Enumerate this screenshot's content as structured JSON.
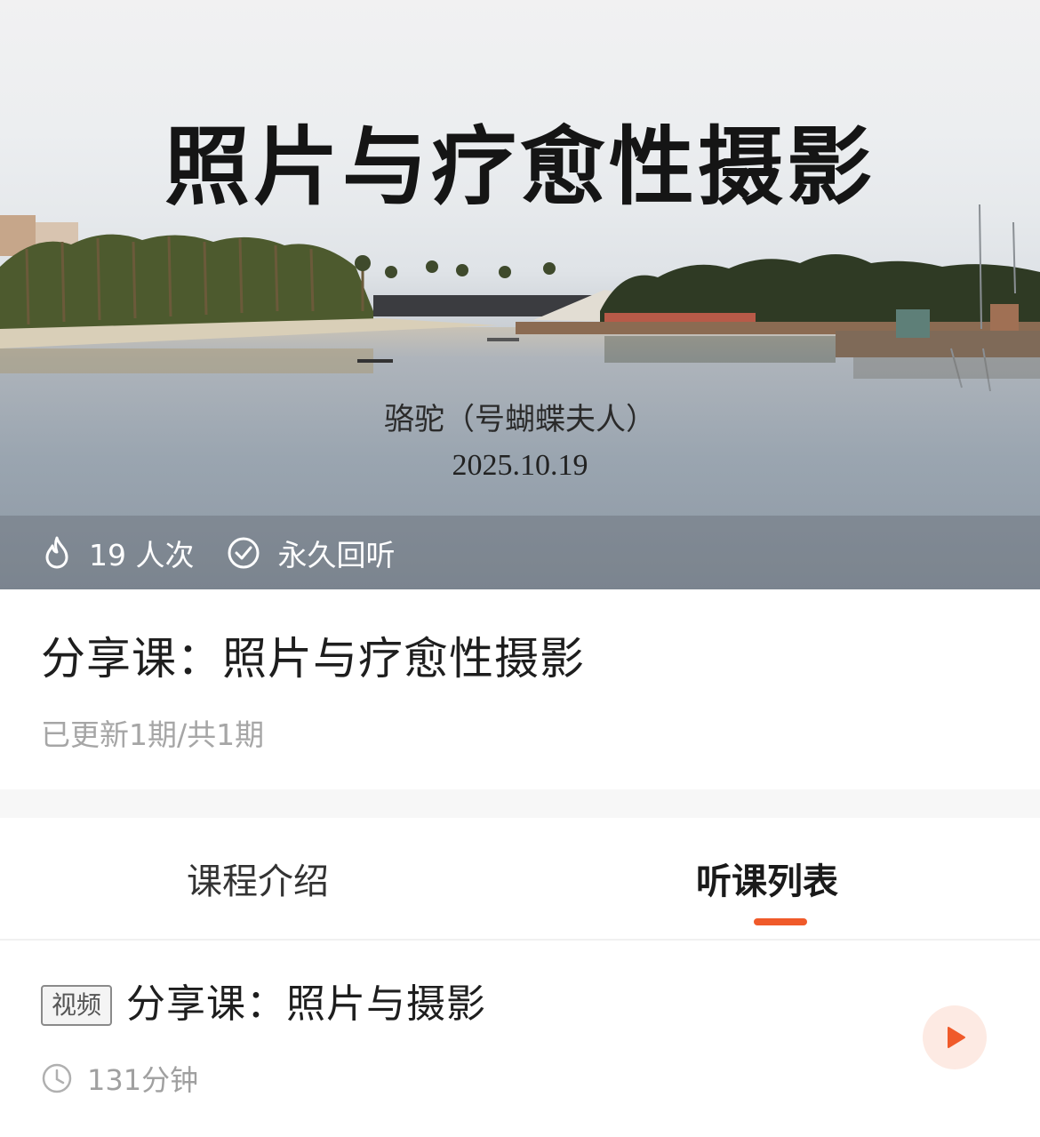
{
  "cover": {
    "title": "照片与疗愈性摄影",
    "author": "骆驼（号蝴蝶夫人）",
    "date": "2025.10.19",
    "stats": {
      "views_text": "19 人次",
      "replay_text": "永久回听",
      "views_icon": "flame-icon",
      "replay_icon": "check-circle-icon"
    }
  },
  "course": {
    "title": "分享课：照片与疗愈性摄影",
    "progress": "已更新1期/共1期"
  },
  "tabs": [
    {
      "label": "课程介绍",
      "active": false
    },
    {
      "label": "听课列表",
      "active": true
    }
  ],
  "lessons": [
    {
      "type_badge": "视频",
      "title": "分享课：照片与摄影",
      "duration": "131分钟",
      "duration_icon": "clock-icon",
      "action_icon": "play-icon"
    }
  ],
  "colors": {
    "accent": "#f05a2a",
    "play_bg": "#fdeae3",
    "muted_text": "#a6a6a6"
  }
}
